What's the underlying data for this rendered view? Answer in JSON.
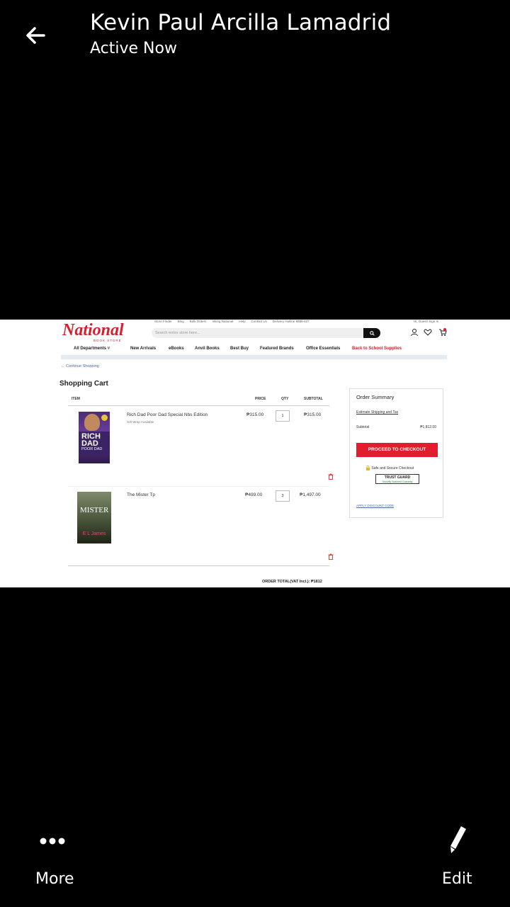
{
  "header": {
    "contact_name": "Kevin Paul Arcilla Lamadrid",
    "status": "Active Now"
  },
  "store": {
    "logo_text": "National",
    "logo_sub": "BOOK STORE",
    "top_links": [
      "Store Finder",
      "Blog",
      "Bulk Orders",
      "Inking National",
      "Help",
      "Contact Us",
      "Delivery Hotline 8888-627"
    ],
    "account_link": "Hi, Guest! Sign In",
    "search_placeholder": "Search entire store here...",
    "nav": [
      "All Departments ˅",
      "New Arrivals",
      "eBooks",
      "Anvil Books",
      "Best Buy",
      "Featured Brands",
      "Office Essentials",
      "Back to School Supplies"
    ],
    "continue_shopping": "← Continue Shopping",
    "page_title": "Shopping Cart",
    "columns": {
      "item": "ITEM",
      "price": "PRICE",
      "qty": "QTY",
      "subtotal": "SUBTOTAL"
    },
    "items": [
      {
        "title": "Rich Dad Poor Dad Special Nbs Edition",
        "meta": "Gift Wrap Available",
        "price": "₱315.00",
        "qty": "1",
        "subtotal": "₱315.00",
        "cover_title": "RICH DAD",
        "cover_sub": "POOR DAD"
      },
      {
        "title": "The Mister Tp",
        "price": "₱499.00",
        "qty": "3",
        "subtotal": "₱1,497.00",
        "cover_title": "MISTER",
        "cover_author": "E L James"
      }
    ],
    "summary": {
      "title": "Order Summary",
      "estimate": "Estimate Shipping and Tax",
      "subtotal_label": "Subtotal",
      "subtotal_value": "₱1,812.00",
      "checkout": "PROCEED TO CHECKOUT",
      "secure": "Safe and Secure Checkout",
      "trust": "TRUST GUARD",
      "trust_sub": "Security Scanned Guaranty",
      "apply_discount": "APPLY DISCOUNT CODE"
    },
    "order_total": "ORDER TOTAL(VAT Incl.): ₱1812"
  },
  "footer": {
    "more": "More",
    "edit": "Edit"
  },
  "colors": {
    "brand_red": "#d6202c",
    "checkout_red": "#e11d2e"
  },
  "icons": [
    "back-arrow-icon",
    "search-icon",
    "user-icon",
    "heart-icon",
    "cart-icon",
    "trash-icon",
    "lock-icon",
    "more-dots-icon",
    "pencil-icon"
  ]
}
